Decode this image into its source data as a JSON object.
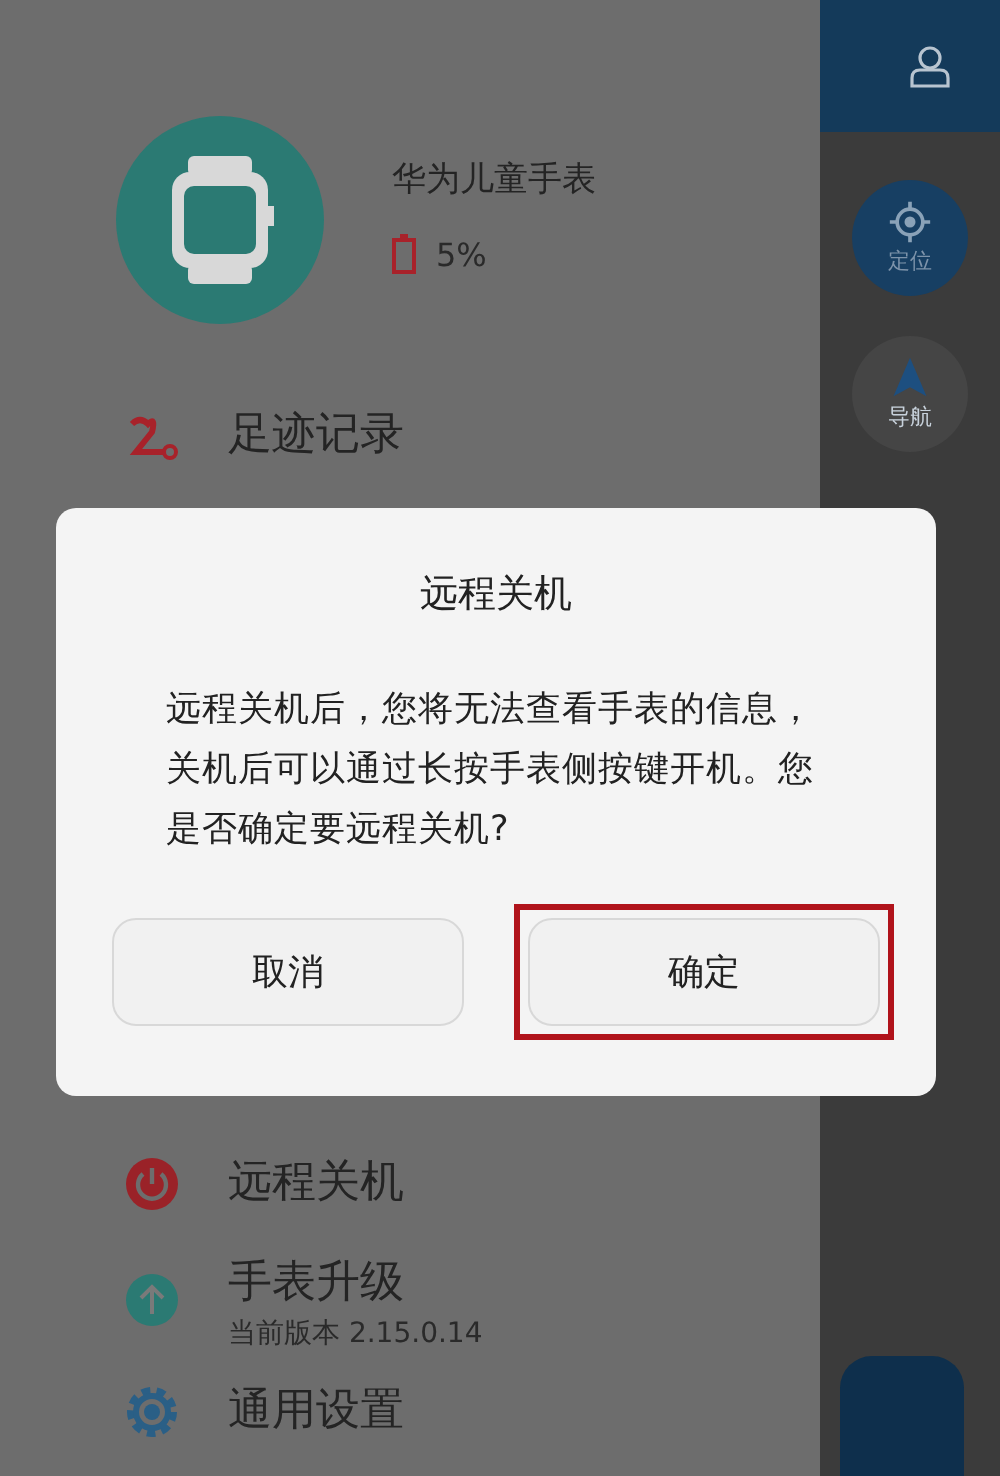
{
  "drawer": {
    "device": {
      "name": "华为儿童手表",
      "battery": "5%",
      "battery_low": true
    },
    "menu": [
      {
        "kind": "footprint",
        "label": "足迹记录"
      },
      {
        "kind": "power",
        "label": "远程关机"
      },
      {
        "kind": "upgrade",
        "label": "手表升级",
        "subtitle": "当前版本 2.15.0.14"
      },
      {
        "kind": "settings",
        "label": "通用设置"
      }
    ]
  },
  "side_buttons": [
    {
      "kind": "locate",
      "label": "定位"
    },
    {
      "kind": "navigate",
      "label": "导航"
    }
  ],
  "dialog": {
    "title": "远程关机",
    "message": "远程关机后，您将无法查看手表的信息，关机后可以通过长按手表侧按键开机。您是否确定要远程关机?",
    "buttons": [
      {
        "label": "取消",
        "highlighted": false
      },
      {
        "label": "确定",
        "highlighted": true
      }
    ]
  }
}
